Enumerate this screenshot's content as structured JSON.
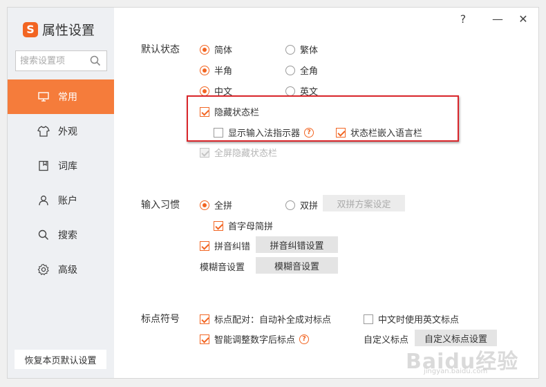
{
  "window": {
    "help_label": "?",
    "minimize_label": "—",
    "close_label": "✕"
  },
  "sidebar": {
    "app_title": "属性设置",
    "logo_text": "S",
    "search_placeholder": "搜索设置项",
    "items": [
      {
        "label": "常用",
        "icon": "monitor-icon",
        "active": true
      },
      {
        "label": "外观",
        "icon": "shirt-icon",
        "active": false
      },
      {
        "label": "词库",
        "icon": "book-icon",
        "active": false
      },
      {
        "label": "账户",
        "icon": "user-icon",
        "active": false
      },
      {
        "label": "搜索",
        "icon": "search-icon",
        "active": false
      },
      {
        "label": "高级",
        "icon": "gear-icon",
        "active": false
      }
    ],
    "restore_label": "恢复本页默认设置"
  },
  "default_state": {
    "section_label": "默认状态",
    "simplified": "简体",
    "traditional": "繁体",
    "half_width": "半角",
    "full_width": "全角",
    "chinese": "中文",
    "english": "英文",
    "hide_status_bar": "隐藏状态栏",
    "show_ime_indicator": "显示输入法指示器",
    "embed_language_bar": "状态栏嵌入语言栏",
    "fullscreen_hide": "全屏隐藏状态栏",
    "help_glyph": "?"
  },
  "input_habit": {
    "section_label": "输入习惯",
    "full_pinyin": "全拼",
    "double_pinyin": "双拼",
    "double_scheme_btn": "双拼方案设定",
    "initial_abbrev": "首字母简拼",
    "pinyin_correction": "拼音纠错",
    "pinyin_correction_btn": "拼音纠错设置",
    "fuzzy_label": "模糊音设置",
    "fuzzy_btn": "模糊音设置"
  },
  "punctuation": {
    "section_label": "标点符号",
    "auto_pair": "标点配对：自动补全成对标点",
    "english_punct": "中文时使用英文标点",
    "smart_number": "智能调整数字后标点",
    "custom_label": "自定义标点",
    "custom_btn": "自定义标点设置"
  },
  "watermark": {
    "text": "Baidu经验",
    "sub": "jingyan.baidu.com"
  },
  "colors": {
    "accent": "#f26522",
    "active_nav": "#f57c3b",
    "highlight": "#d9252a"
  }
}
